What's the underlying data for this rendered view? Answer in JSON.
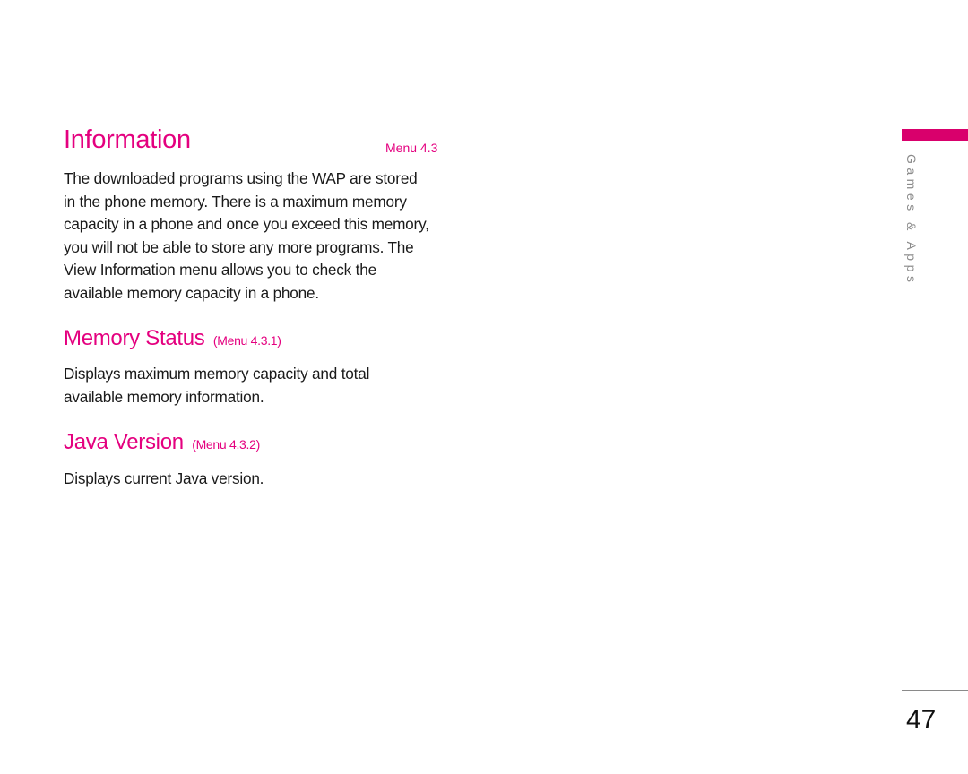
{
  "section": {
    "title": "Information",
    "menu_ref": "Menu 4.3",
    "intro_lines": [
      "The downloaded programs using the WAP are stored",
      "in the phone memory. There is a maximum memory",
      "capacity in a phone and once you exceed this memory,",
      "you will not be able to store any more programs. The",
      "View Information menu allows you to check the",
      "available memory capacity in a phone."
    ]
  },
  "subsections": [
    {
      "title": "Memory Status",
      "menu_ref": "(Menu 4.3.1)",
      "lines": [
        "Displays maximum memory capacity and total",
        "available memory information."
      ]
    },
    {
      "title": "Java Version",
      "menu_ref": "(Menu 4.3.2)",
      "lines": [
        "Displays current Java version."
      ]
    }
  ],
  "side_tab": {
    "label": "Games & Apps",
    "color": "#d9006c"
  },
  "page_number": "47",
  "accent_color": "#e4007f"
}
